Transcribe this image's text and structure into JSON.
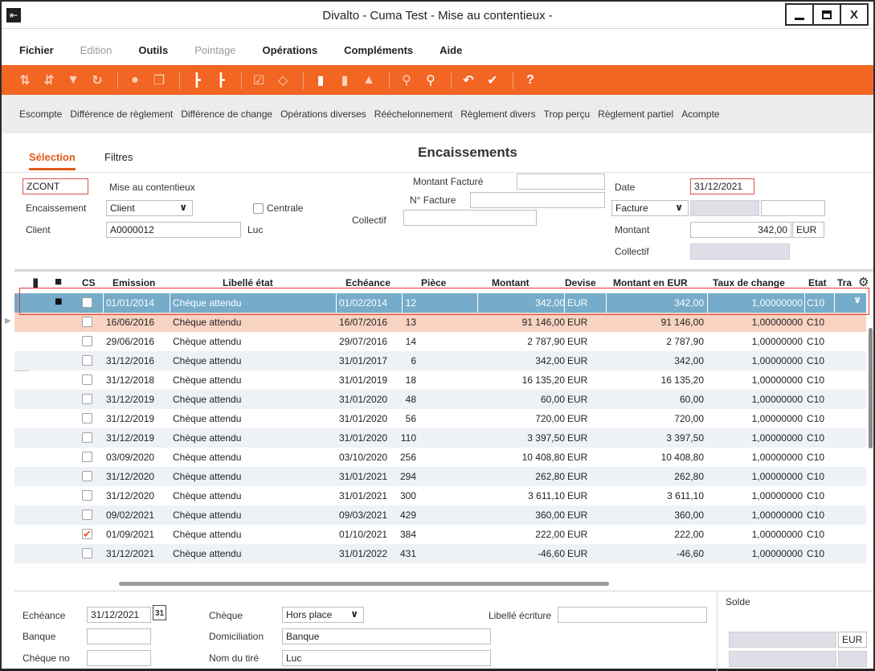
{
  "window": {
    "title": "Divalto - Cuma Test - Mise au contentieux -",
    "close_glyph": "X"
  },
  "menu": [
    {
      "label": "Fichier",
      "disabled": false
    },
    {
      "label": "Edition",
      "disabled": true
    },
    {
      "label": "Outils",
      "disabled": false
    },
    {
      "label": "Pointage",
      "disabled": true
    },
    {
      "label": "Opérations",
      "disabled": false
    },
    {
      "label": "Compléments",
      "disabled": false
    },
    {
      "label": "Aide",
      "disabled": false
    }
  ],
  "toolbar": {
    "accent": "#f26522",
    "icons": [
      "sort-asc-icon",
      "sort-desc-icon",
      "filter-icon",
      "refresh-icon",
      "group-icon",
      "copy-icon",
      "tree-icon",
      "tree-add-icon",
      "check-box-icon",
      "eraser-icon",
      "document-icon",
      "document-add-icon",
      "hierarchy-icon",
      "search-icon",
      "search-add-icon",
      "undo-icon",
      "validate-icon",
      "help-icon"
    ],
    "help": "?"
  },
  "actions": [
    "Escompte",
    "Différence de règlement",
    "Différence de change",
    "Opérations diverses",
    "Rééchelonnement",
    "Règlement divers",
    "Trop perçu",
    "Règlement partiel",
    "Acompte"
  ],
  "tabs": {
    "selection": "Sélection",
    "filtres": "Filtres"
  },
  "section_title": "Encaissements",
  "form": {
    "code": "ZCONT",
    "mode_label": "Mise au contentieux",
    "encaissement_label": "Encaissement",
    "encaissement_value": "Client",
    "centrale_label": "Centrale",
    "client_label": "Client",
    "client_value": "A0000012",
    "client_name": "Luc",
    "montant_facture_label": "Montant Facturé",
    "montant_facture_value": "",
    "no_facture_label": "N° Facture",
    "no_facture_value": "",
    "collectif_label": "Collectif",
    "collectif_value": "",
    "date_label": "Date",
    "date_value": "31/12/2021",
    "type_value": "Facture",
    "montant_label": "Montant",
    "montant_value": "342,00",
    "currency": "EUR",
    "collectif2_label": "Collectif"
  },
  "grid": {
    "headers": [
      "CS",
      "Emission",
      "Libellé état",
      "Echéance",
      "Pièce",
      "Montant",
      "Devise",
      "Montant en EUR",
      "Taux de change",
      "Etat",
      "Tra"
    ],
    "rows": [
      {
        "emission": "01/01/2014",
        "libelle": "Chèque attendu",
        "echeance": "01/02/2014",
        "piece": "12",
        "montant": "342,00",
        "devise": "EUR",
        "montant_eur": "342,00",
        "taux": "1,00000000",
        "etat": "C10",
        "checked": false,
        "locked": true,
        "style": "sel"
      },
      {
        "emission": "16/06/2016",
        "libelle": "Chèque attendu",
        "echeance": "16/07/2016",
        "piece": "13",
        "montant": "91 146,00",
        "devise": "EUR",
        "montant_eur": "91 146,00",
        "taux": "1,00000000",
        "etat": "C10",
        "checked": false,
        "locked": false,
        "style": "hl"
      },
      {
        "emission": "29/06/2016",
        "libelle": "Chèque attendu",
        "echeance": "29/07/2016",
        "piece": "14",
        "montant": "2 787,90",
        "devise": "EUR",
        "montant_eur": "2 787,90",
        "taux": "1,00000000",
        "etat": "C10",
        "checked": false,
        "locked": false,
        "style": ""
      },
      {
        "emission": "31/12/2016",
        "libelle": "Chèque attendu",
        "echeance": "31/01/2017",
        "piece": "6",
        "montant": "342,00",
        "devise": "EUR",
        "montant_eur": "342,00",
        "taux": "1,00000000",
        "etat": "C10",
        "checked": false,
        "locked": false,
        "style": "alt"
      },
      {
        "emission": "31/12/2018",
        "libelle": "Chèque attendu",
        "echeance": "31/01/2019",
        "piece": "18",
        "montant": "16 135,20",
        "devise": "EUR",
        "montant_eur": "16 135,20",
        "taux": "1,00000000",
        "etat": "C10",
        "checked": false,
        "locked": false,
        "style": ""
      },
      {
        "emission": "31/12/2019",
        "libelle": "Chèque attendu",
        "echeance": "31/01/2020",
        "piece": "48",
        "montant": "60,00",
        "devise": "EUR",
        "montant_eur": "60,00",
        "taux": "1,00000000",
        "etat": "C10",
        "checked": false,
        "locked": false,
        "style": "alt"
      },
      {
        "emission": "31/12/2019",
        "libelle": "Chèque attendu",
        "echeance": "31/01/2020",
        "piece": "56",
        "montant": "720,00",
        "devise": "EUR",
        "montant_eur": "720,00",
        "taux": "1,00000000",
        "etat": "C10",
        "checked": false,
        "locked": false,
        "style": ""
      },
      {
        "emission": "31/12/2019",
        "libelle": "Chèque attendu",
        "echeance": "31/01/2020",
        "piece": "110",
        "montant": "3 397,50",
        "devise": "EUR",
        "montant_eur": "3 397,50",
        "taux": "1,00000000",
        "etat": "C10",
        "checked": false,
        "locked": false,
        "style": "alt"
      },
      {
        "emission": "03/09/2020",
        "libelle": "Chèque attendu",
        "echeance": "03/10/2020",
        "piece": "256",
        "montant": "10 408,80",
        "devise": "EUR",
        "montant_eur": "10 408,80",
        "taux": "1,00000000",
        "etat": "C10",
        "checked": false,
        "locked": false,
        "style": ""
      },
      {
        "emission": "31/12/2020",
        "libelle": "Chèque attendu",
        "echeance": "31/01/2021",
        "piece": "294",
        "montant": "262,80",
        "devise": "EUR",
        "montant_eur": "262,80",
        "taux": "1,00000000",
        "etat": "C10",
        "checked": false,
        "locked": false,
        "style": "alt"
      },
      {
        "emission": "31/12/2020",
        "libelle": "Chèque attendu",
        "echeance": "31/01/2021",
        "piece": "300",
        "montant": "3 611,10",
        "devise": "EUR",
        "montant_eur": "3 611,10",
        "taux": "1,00000000",
        "etat": "C10",
        "checked": false,
        "locked": false,
        "style": ""
      },
      {
        "emission": "09/02/2021",
        "libelle": "Chèque attendu",
        "echeance": "09/03/2021",
        "piece": "429",
        "montant": "360,00",
        "devise": "EUR",
        "montant_eur": "360,00",
        "taux": "1,00000000",
        "etat": "C10",
        "checked": false,
        "locked": false,
        "style": "alt"
      },
      {
        "emission": "01/09/2021",
        "libelle": "Chèque attendu",
        "echeance": "01/10/2021",
        "piece": "384",
        "montant": "222,00",
        "devise": "EUR",
        "montant_eur": "222,00",
        "taux": "1,00000000",
        "etat": "C10",
        "checked": true,
        "locked": false,
        "style": ""
      },
      {
        "emission": "31/12/2021",
        "libelle": "Chèque attendu",
        "echeance": "31/01/2022",
        "piece": "431",
        "montant": "-46,60",
        "devise": "EUR",
        "montant_eur": "-46,60",
        "taux": "1,00000000",
        "etat": "C10",
        "checked": false,
        "locked": false,
        "style": "alt"
      }
    ]
  },
  "bottom": {
    "echeance_label": "Echéance",
    "echeance_value": "31/12/2021",
    "calendar_day": "31",
    "banque_label": "Banque",
    "banque_value": "",
    "cheque_no_label": "Chèque no",
    "cheque_no_value": "",
    "cheque_label": "Chèque",
    "cheque_value": "Hors place",
    "domiciliation_label": "Domiciliation",
    "domiciliation_value": "Banque",
    "nom_tire_label": "Nom du tiré",
    "nom_tire_value": "Luc",
    "libelle_ecriture_label": "Libellé écriture",
    "libelle_ecriture_value": "",
    "solde_label": "Solde",
    "solde_currency": "EUR"
  }
}
